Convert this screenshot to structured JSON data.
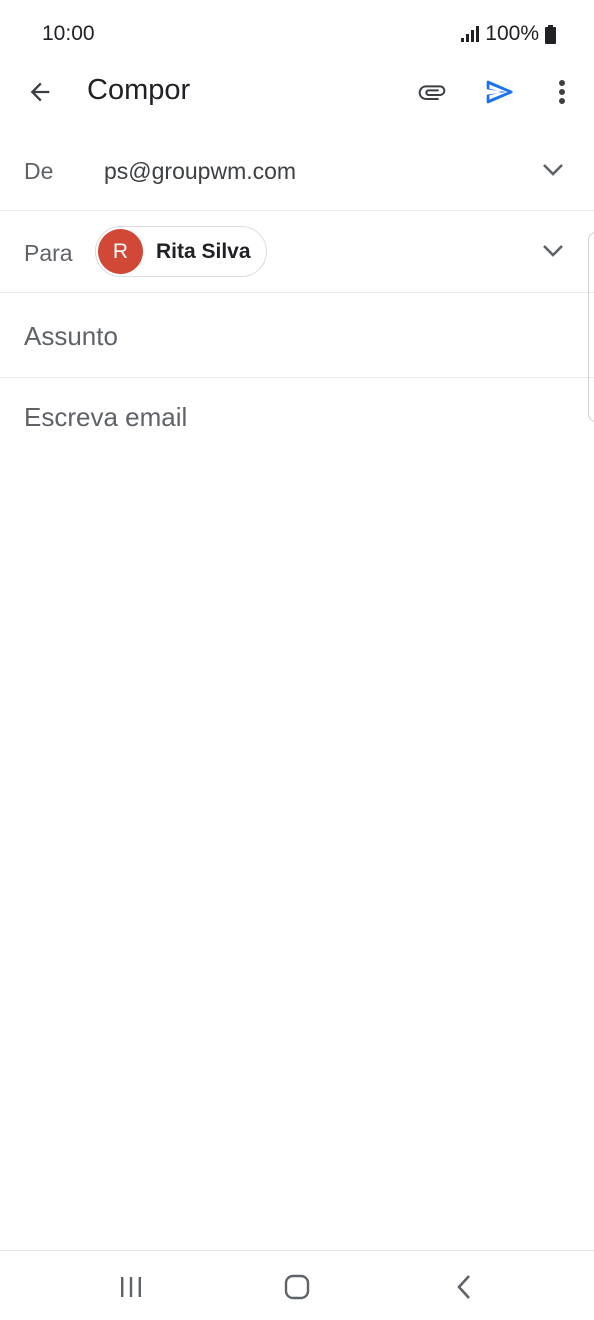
{
  "status_bar": {
    "time": "10:00",
    "battery": "100%"
  },
  "app_bar": {
    "title": "Compor"
  },
  "compose": {
    "from_label": "De",
    "from_value": "ps@groupwm.com",
    "to_label": "Para",
    "recipient": {
      "initial": "R",
      "name": "Rita Silva",
      "avatar_color": "#d14836"
    },
    "subject_placeholder": "Assunto",
    "body_placeholder": "Escreva email"
  },
  "colors": {
    "accent": "#1a73e8",
    "text": "#202124",
    "secondary_text": "#5f6368"
  },
  "icons": [
    "back-arrow-icon",
    "paperclip-icon",
    "send-icon",
    "more-vert-icon",
    "chevron-down-icon",
    "signal-icon",
    "battery-icon",
    "recents-icon",
    "home-icon",
    "nav-back-icon"
  ]
}
